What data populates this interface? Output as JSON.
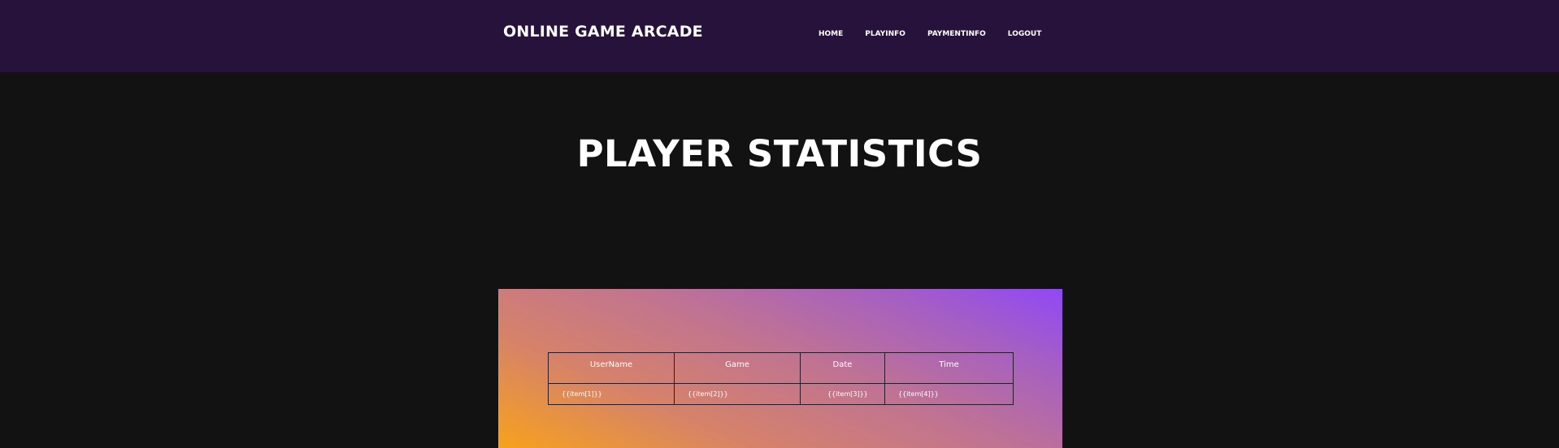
{
  "header": {
    "brand": "ONLINE GAME ARCADE",
    "nav": [
      "HOME",
      "PLAYINFO",
      "PAYMENTINFO",
      "LOGOUT"
    ]
  },
  "main": {
    "title": "PLAYER STATISTICS",
    "table": {
      "columns": [
        "UserName",
        "Game",
        "Date",
        "Time"
      ],
      "rows": [
        [
          "{{item[1]}}",
          "{{item[2]}}",
          "{{item[3]}}",
          "{{item[4]}}"
        ]
      ]
    }
  },
  "colors": {
    "navbar": "#26123b",
    "background": "#121212",
    "gradient_start": "#f7a21c",
    "gradient_end": "#9048f6"
  }
}
